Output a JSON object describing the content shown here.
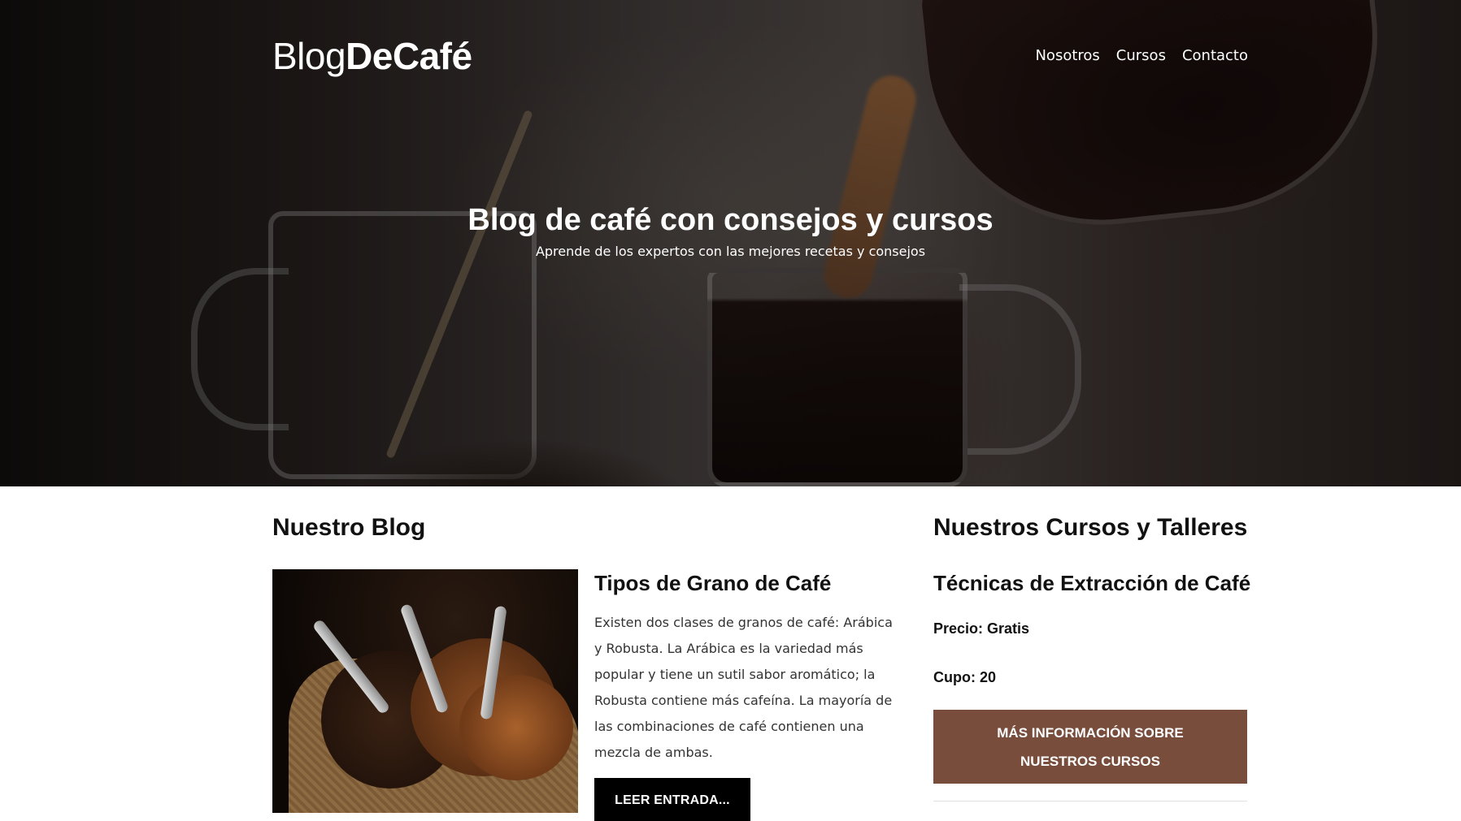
{
  "header": {
    "logo_light": "Blog",
    "logo_bold": "DeCafé",
    "nav": [
      {
        "label": "Nosotros"
      },
      {
        "label": "Cursos"
      },
      {
        "label": "Contacto"
      }
    ]
  },
  "hero": {
    "title": "Blog de café con consejos y cursos",
    "subtitle": "Aprende de los expertos con las mejores recetas y consejos"
  },
  "blog": {
    "heading": "Nuestro Blog",
    "post": {
      "title": "Tipos de Grano de Café",
      "text": "Existen dos clases de granos de café: Arábica y Robusta. La Arábica es la variedad más popular y tiene un sutil sabor aromático; la Robusta contiene más cafeína. La mayoría de las combinaciones de café contienen una mezcla de ambas.",
      "button": "Leer Entrada..."
    }
  },
  "courses": {
    "heading": "Nuestros Cursos y Talleres",
    "course": {
      "title": "Técnicas de Extracción de Café",
      "price": "Precio: Gratis",
      "cupo": "Cupo: 20"
    },
    "button": "Más información sobre nuestros cursos"
  },
  "colors": {
    "accent_button": "#784d3c",
    "dark_button": "#000000"
  }
}
